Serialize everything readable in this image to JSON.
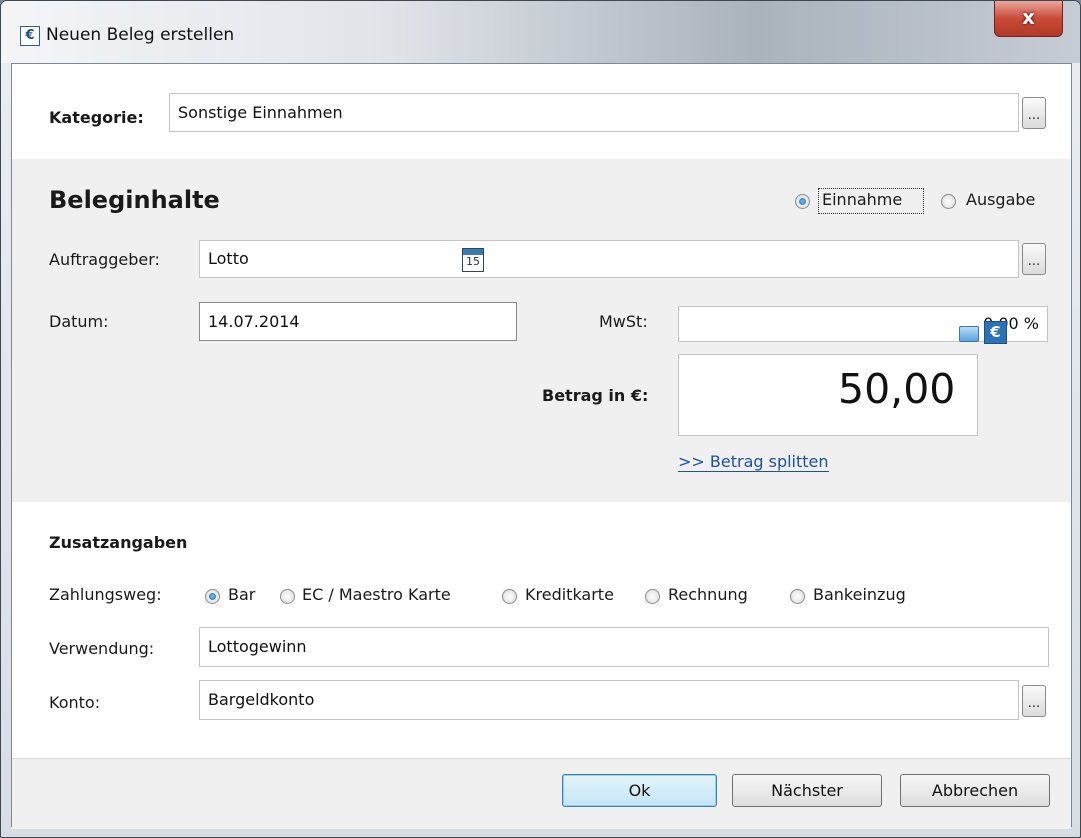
{
  "window": {
    "title": "Neuen Beleg erstellen",
    "close_glyph": "x",
    "icon": "euro-icon"
  },
  "kategorie": {
    "label": "Kategorie:",
    "value": "Sonstige Einnahmen",
    "browse": "..."
  },
  "beleg": {
    "heading": "Beleginhalte",
    "type_options": [
      {
        "label": "Einnahme",
        "selected": true
      },
      {
        "label": "Ausgabe",
        "selected": false
      }
    ],
    "auftraggeber": {
      "label": "Auftraggeber:",
      "value": "Lotto",
      "browse": "..."
    },
    "datum": {
      "label": "Datum:",
      "value": "14.07.2014",
      "calendar_day": "15"
    },
    "mwst": {
      "label": "MwSt:",
      "value": "0,00 %"
    },
    "betrag": {
      "label": "Betrag in €:",
      "value": "50,00",
      "currency_glyph": "€"
    },
    "split_link": ">> Betrag splitten"
  },
  "zusatz": {
    "heading": "Zusatzangaben",
    "zahlungsweg": {
      "label": "Zahlungsweg:",
      "options": [
        {
          "label": "Bar",
          "selected": true
        },
        {
          "label": "EC / Maestro Karte",
          "selected": false
        },
        {
          "label": "Kreditkarte",
          "selected": false
        },
        {
          "label": "Rechnung",
          "selected": false
        },
        {
          "label": "Bankeinzug",
          "selected": false
        }
      ]
    },
    "verwendung": {
      "label": "Verwendung:",
      "value": "Lottogewinn"
    },
    "konto": {
      "label": "Konto:",
      "value": "Bargeldkonto",
      "browse": "..."
    }
  },
  "buttons": {
    "ok": "Ok",
    "next": "Nächster",
    "cancel": "Abbrechen"
  },
  "colors": {
    "accent": "#1c62b5",
    "link": "#1c4fa6",
    "close": "#c94a37"
  }
}
